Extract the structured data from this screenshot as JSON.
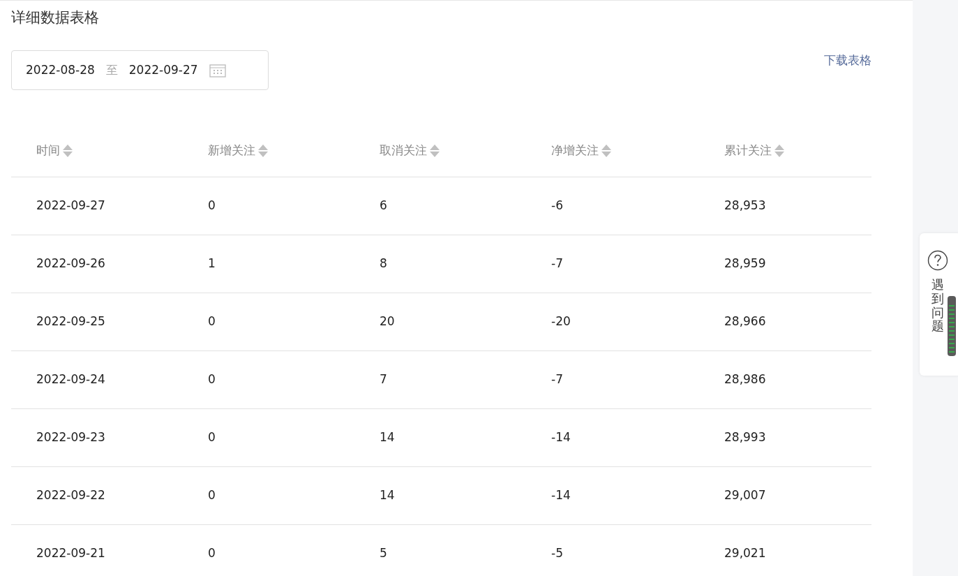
{
  "title": "详细数据表格",
  "date_range": {
    "start": "2022-08-28",
    "separator": "至",
    "end": "2022-09-27"
  },
  "download_link": "下载表格",
  "table": {
    "columns": [
      "时间",
      "新增关注",
      "取消关注",
      "净增关注",
      "累计关注"
    ],
    "rows": [
      [
        "2022-09-27",
        "0",
        "6",
        "-6",
        "28,953"
      ],
      [
        "2022-09-26",
        "1",
        "8",
        "-7",
        "28,959"
      ],
      [
        "2022-09-25",
        "0",
        "20",
        "-20",
        "28,966"
      ],
      [
        "2022-09-24",
        "0",
        "7",
        "-7",
        "28,986"
      ],
      [
        "2022-09-23",
        "0",
        "14",
        "-14",
        "28,993"
      ],
      [
        "2022-09-22",
        "0",
        "14",
        "-14",
        "29,007"
      ],
      [
        "2022-09-21",
        "0",
        "5",
        "-5",
        "29,021"
      ]
    ]
  },
  "feedback_tab": {
    "label": "遇到问题"
  }
}
